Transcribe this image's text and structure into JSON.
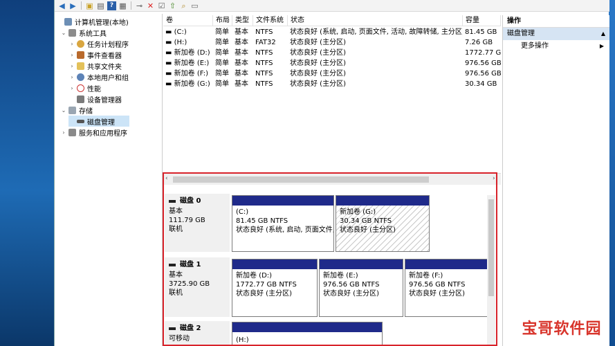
{
  "tree": {
    "root": "计算机管理(本地)",
    "system_tools": "系统工具",
    "task_scheduler": "任务计划程序",
    "event_viewer": "事件查看器",
    "shared_folders": "共享文件夹",
    "local_users": "本地用户和组",
    "performance": "性能",
    "device_manager": "设备管理器",
    "storage": "存储",
    "disk_management": "磁盘管理",
    "services_apps": "服务和应用程序"
  },
  "volumes": {
    "headers": [
      "卷",
      "布局",
      "类型",
      "文件系统",
      "状态",
      "容量"
    ],
    "rows": [
      {
        "name": "(C:)",
        "layout": "简单",
        "type": "基本",
        "fs": "NTFS",
        "status": "状态良好 (系统, 启动, 页面文件, 活动, 故障转储, 主分区)",
        "capacity": "81.45 GB"
      },
      {
        "name": "(H:)",
        "layout": "简单",
        "type": "基本",
        "fs": "FAT32",
        "status": "状态良好 (主分区)",
        "capacity": "7.26 GB"
      },
      {
        "name": "新加卷 (D:)",
        "layout": "简单",
        "type": "基本",
        "fs": "NTFS",
        "status": "状态良好 (主分区)",
        "capacity": "1772.77 GB"
      },
      {
        "name": "新加卷 (E:)",
        "layout": "简单",
        "type": "基本",
        "fs": "NTFS",
        "status": "状态良好 (主分区)",
        "capacity": "976.56 GB"
      },
      {
        "name": "新加卷 (F:)",
        "layout": "简单",
        "type": "基本",
        "fs": "NTFS",
        "status": "状态良好 (主分区)",
        "capacity": "976.56 GB"
      },
      {
        "name": "新加卷 (G:)",
        "layout": "简单",
        "type": "基本",
        "fs": "NTFS",
        "status": "状态良好 (主分区)",
        "capacity": "30.34 GB"
      }
    ]
  },
  "disks": [
    {
      "title": "磁盘 0",
      "type": "基本",
      "size": "111.79 GB",
      "state": "联机",
      "parts": [
        {
          "name": "(C:)",
          "size": "81.45 GB NTFS",
          "status": "状态良好 (系统, 启动, 页面文件,"
        },
        {
          "name": "新加卷 (G:)",
          "size": "30.34 GB NTFS",
          "status": "状态良好 (主分区)"
        }
      ]
    },
    {
      "title": "磁盘 1",
      "type": "基本",
      "size": "3725.90 GB",
      "state": "联机",
      "parts": [
        {
          "name": "新加卷 (D:)",
          "size": "1772.77 GB NTFS",
          "status": "状态良好 (主分区)"
        },
        {
          "name": "新加卷 (E:)",
          "size": "976.56 GB NTFS",
          "status": "状态良好 (主分区)"
        },
        {
          "name": "新加卷 (F:)",
          "size": "976.56 GB NTFS",
          "status": "状态良好 (主分区)"
        }
      ]
    },
    {
      "title": "磁盘 2",
      "type": "可移动",
      "parts": [
        {
          "name": "(H:)"
        }
      ]
    }
  ],
  "actions": {
    "title": "操作",
    "section": "磁盘管理",
    "more": "更多操作"
  },
  "watermark": "宝哥软件园",
  "colors": {
    "partition_bar": "#1f2a8a",
    "highlight_border": "#d8222a",
    "selection": "#cce4f7"
  }
}
